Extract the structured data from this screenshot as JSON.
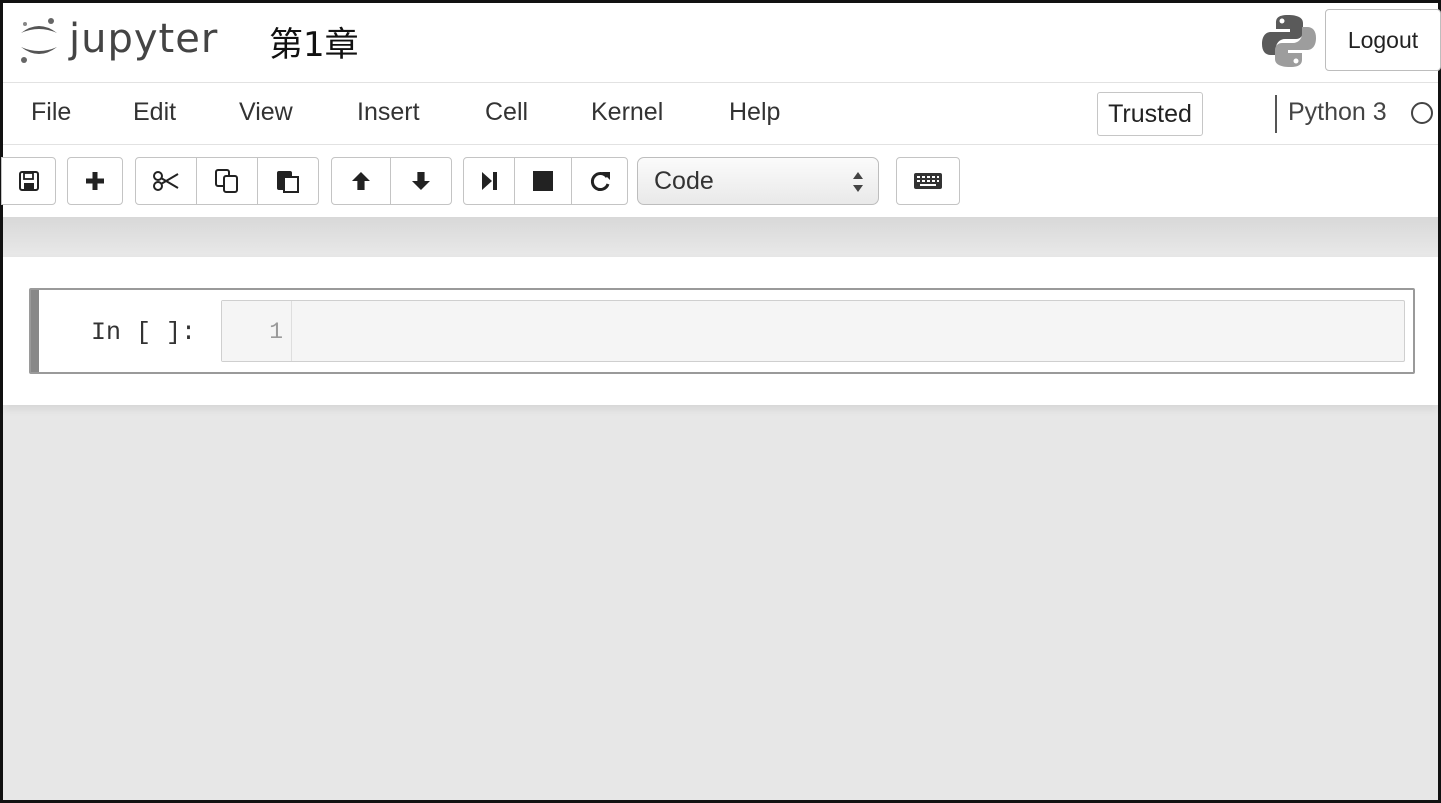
{
  "header": {
    "logo_text": "jupyter",
    "notebook_title": "第1章",
    "logout_label": "Logout",
    "kernel_logo_icon": "python-logo-icon"
  },
  "menubar": {
    "items": [
      "File",
      "Edit",
      "View",
      "Insert",
      "Cell",
      "Kernel",
      "Help"
    ],
    "trusted_label": "Trusted",
    "kernel_name": "Python 3",
    "kernel_status_icon": "kernel-idle-circle-icon"
  },
  "toolbar": {
    "icons": {
      "save": "save-icon",
      "insert": "plus-icon",
      "cut": "scissors-icon",
      "copy": "copy-icon",
      "paste": "paste-icon",
      "move_up": "arrow-up-icon",
      "move_down": "arrow-down-icon",
      "run": "step-forward-icon",
      "interrupt": "stop-icon",
      "restart": "restart-icon",
      "command_palette": "keyboard-icon"
    },
    "cell_type_value": "Code"
  },
  "cell": {
    "prompt": "In [ ]:",
    "line_number": "1"
  },
  "colors": {
    "page_background": "#e7e7e7",
    "panel_background": "#ffffff",
    "cell_border": "#9a9a9a"
  }
}
